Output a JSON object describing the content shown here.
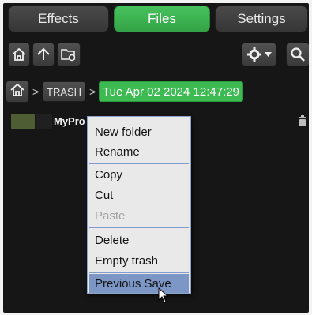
{
  "tabs": [
    {
      "label": "Effects",
      "active": false
    },
    {
      "label": "Files",
      "active": true
    },
    {
      "label": "Settings",
      "active": false
    }
  ],
  "toolbar": {
    "left_icons": [
      "home-icon",
      "arrow-up-icon",
      "new-folder-icon"
    ],
    "right_icons": [
      "gear-icon",
      "chevron-down-icon",
      "search-icon"
    ]
  },
  "breadcrumb": {
    "separator": ">",
    "items": [
      "TRASH",
      "Tue Apr 02 2024 12:47:29"
    ]
  },
  "files": [
    {
      "name": "MyPro"
    }
  ],
  "context_menu": {
    "items": [
      {
        "label": "New folder"
      },
      {
        "label": "Rename"
      },
      {
        "label": "Copy"
      },
      {
        "label": "Cut"
      },
      {
        "label": "Paste",
        "disabled": true
      },
      {
        "label": "Delete"
      },
      {
        "label": "Empty trash"
      },
      {
        "label": "Previous Save",
        "highlighted": true
      }
    ]
  },
  "colors": {
    "accent_green": "#3dbb52",
    "menu_highlight": "#7c97c6",
    "background": "#161616"
  }
}
